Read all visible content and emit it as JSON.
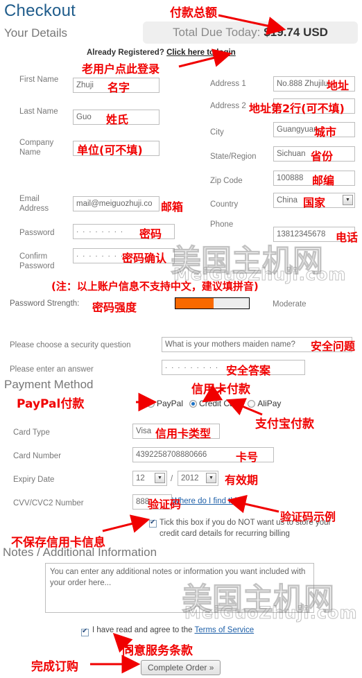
{
  "header": {
    "title": "Checkout",
    "subtitle": "Your Details",
    "total_label": "Total Due Today:",
    "total_amount": "$19.74 USD",
    "already_registered": "Already Registered?",
    "login_link": "Click here to login"
  },
  "left_fields": {
    "first_name_label": "First Name",
    "first_name_value": "Zhuji",
    "last_name_label": "Last Name",
    "last_name_value": "Guo",
    "company_label": "Company Name",
    "company_value": "",
    "email_label": "Email Address",
    "email_value": "mail@meiguozhuji.co",
    "password_label": "Password",
    "password_value": "· · · · · · · ·",
    "confirm_label": "Confirm Password",
    "confirm_value": "· · · · · · · ·"
  },
  "right_fields": {
    "address1_label": "Address 1",
    "address1_value": "No.888 Zhujilu",
    "address2_label": "Address 2",
    "address2_value": "",
    "city_label": "City",
    "city_value": "Guangyuan",
    "state_label": "State/Region",
    "state_value": "Sichuan",
    "zip_label": "Zip Code",
    "zip_value": "100888",
    "country_label": "Country",
    "country_value": "China",
    "phone_label": "Phone",
    "phone_value": "13812345678"
  },
  "password_strength": {
    "label": "Password Strength:",
    "level": "Moderate",
    "percent": 52,
    "fill_color": "#f96900",
    "track_color": "#ededed"
  },
  "security": {
    "question_label": "Please choose a security question",
    "question_value": "What is your mothers maiden name?",
    "answer_label": "Please enter an answer",
    "answer_value": "· · · · · · · · ·"
  },
  "payment": {
    "heading": "Payment Method",
    "options": [
      {
        "label": "PayPal",
        "selected": false
      },
      {
        "label": "Credit Card",
        "selected": true
      },
      {
        "label": "AliPay",
        "selected": false
      }
    ],
    "card_type_label": "Card Type",
    "card_type_value": "Visa",
    "card_number_label": "Card Number",
    "card_number_value": "4392258708880666",
    "expiry_label": "Expiry Date",
    "expiry_month": "12",
    "expiry_year": "2012",
    "expiry_sep": "/",
    "cvv_label": "CVV/CVC2 Number",
    "cvv_value": "888",
    "cvv_link": "Where do I find this?",
    "no_store_text": "Tick this box if you do NOT want us to store your credit card details for recurring billing",
    "no_store_checked": true
  },
  "notes": {
    "heading": "Notes / Additional Information",
    "placeholder": "You can enter any additional notes or information you want included with your order here..."
  },
  "footer": {
    "tos_text": "I have read and agree to the",
    "tos_link": "Terms of Service",
    "tos_checked": true,
    "submit_label": "Complete Order »"
  },
  "watermark": {
    "line1": "美国主机网",
    "line2": "MeiGuoZhuji.com"
  },
  "annotations": {
    "total": "付款总额",
    "login": "老用户点此登录",
    "first_name": "名字",
    "last_name": "姓氏",
    "company": "单位(可不填)",
    "email": "邮箱",
    "password": "密码",
    "confirm": "密码确认",
    "note_pinyin": "(注：以上账户信息不支持中文，建议填拼音)",
    "pw_strength": "密码强度",
    "address1": "地址",
    "address2": "地址第2行(可不填)",
    "city": "城市",
    "state": "省份",
    "zip": "邮编",
    "country": "国家",
    "phone": "电话",
    "security_question": "安全问题",
    "security_answer": "安全答案",
    "paypal": "PayPal付款",
    "credit_card": "信用卡付款",
    "alipay": "支付宝付款",
    "card_type": "信用卡类型",
    "card_number": "卡号",
    "expiry": "有效期",
    "cvv": "验证码",
    "cvv_example": "验证码示例",
    "no_store": "不保存信用卡信息",
    "agree_tos": "同意服务条款",
    "complete": "完成订购"
  },
  "colors": {
    "heading_blue": "#1f5c8b",
    "annotation_red": "#f00000",
    "link_blue": "#1d5fa8"
  }
}
